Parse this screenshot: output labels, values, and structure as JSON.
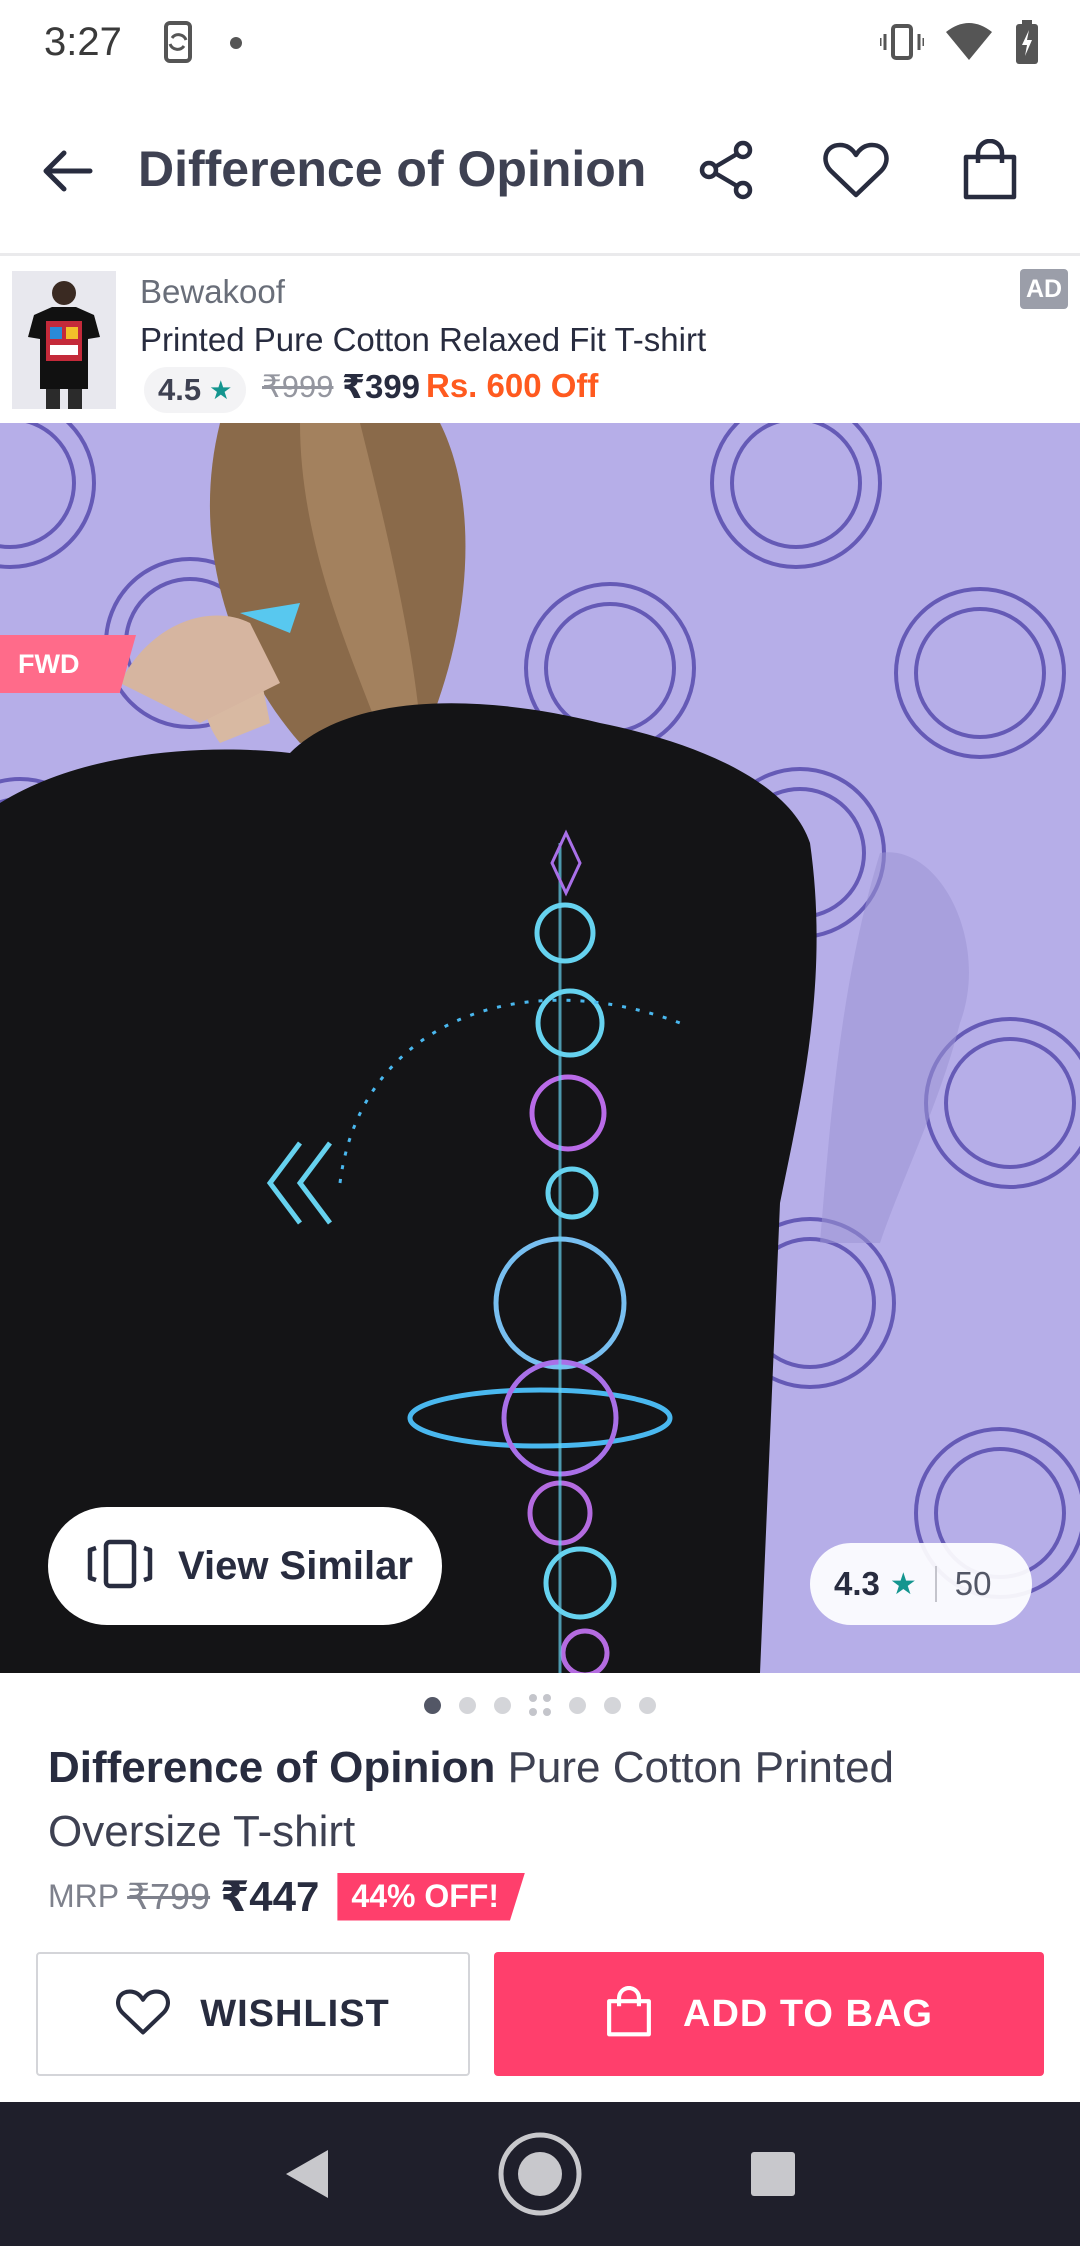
{
  "status_bar": {
    "time": "3:27",
    "icons": [
      "screen-rotation-icon",
      "notification-dot-icon",
      "vibrate-icon",
      "wifi-icon",
      "battery-charging-icon"
    ]
  },
  "app_bar": {
    "title": "Difference of Opinion",
    "icons": [
      "back-arrow-icon",
      "share-icon",
      "heart-icon",
      "shopping-bag-icon"
    ]
  },
  "ad": {
    "brand": "Bewakoof",
    "name": "Printed Pure Cotton Relaxed Fit T-shirt",
    "rating": "4.5",
    "mrp": "₹999",
    "price": "₹399",
    "discount": "Rs. 600 Off",
    "badge": "AD"
  },
  "hero": {
    "fwd_label": "FWD",
    "view_similar_label": "View Similar",
    "rating": "4.3",
    "rating_count": "50",
    "carousel": {
      "count": 7,
      "active_index": 0
    }
  },
  "product": {
    "brand": "Difference of Opinion",
    "name": " Pure Cotton Printed Oversize T-shirt",
    "mrp_label": "MRP",
    "mrp": "₹799",
    "price": "₹447",
    "discount": "44% OFF!"
  },
  "actions": {
    "wishlist_label": "WISHLIST",
    "add_to_bag_label": "ADD TO BAG"
  },
  "colors": {
    "accent": "#ff3f6c",
    "rating_star": "#14958f",
    "ad_discount": "#ff5a1f",
    "nav_bar": "#1f1f2b",
    "hero_background": "#b6aee8"
  }
}
